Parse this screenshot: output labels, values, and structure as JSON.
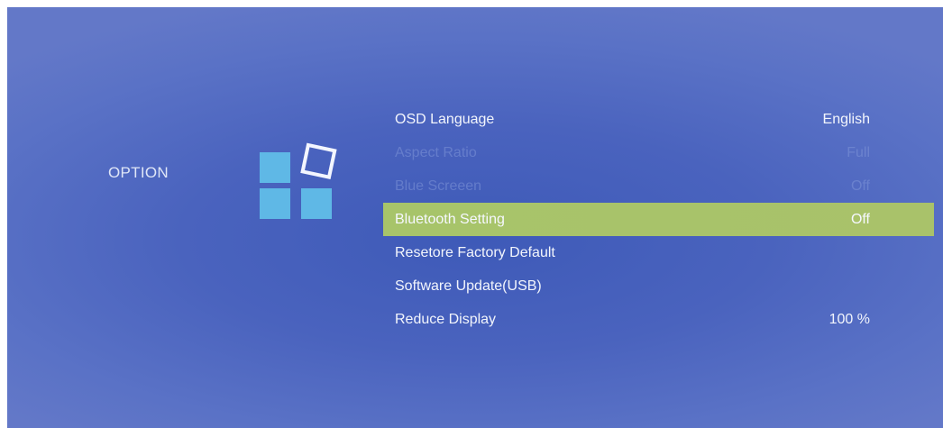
{
  "section": {
    "title": "OPTION",
    "icon": "option-grid-icon"
  },
  "colors": {
    "background": "#4a63be",
    "highlight": "#a8c36a",
    "icon_tile": "#5fb8e6"
  },
  "menu": {
    "items": [
      {
        "label": "OSD Language",
        "value": "English",
        "state": "normal"
      },
      {
        "label": "Aspect Ratio",
        "value": "Full",
        "state": "disabled"
      },
      {
        "label": "Blue Screeen",
        "value": "Off",
        "state": "disabled"
      },
      {
        "label": "Bluetooth Setting",
        "value": "Off",
        "state": "selected"
      },
      {
        "label": "Resetore Factory Default",
        "value": "",
        "state": "normal"
      },
      {
        "label": "Software Update(USB)",
        "value": "",
        "state": "normal"
      },
      {
        "label": "Reduce Display",
        "value": "100 %",
        "state": "normal"
      }
    ]
  }
}
